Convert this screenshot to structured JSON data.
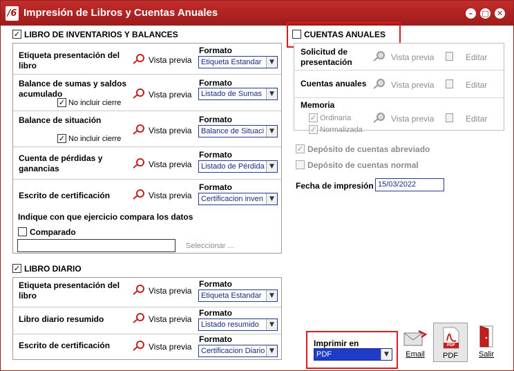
{
  "window": {
    "title": "Impresión de Libros y Cuentas Anuales",
    "logo_text": "/6"
  },
  "inventarios": {
    "checkbox_label": "LIBRO DE INVENTARIOS Y BALANCES",
    "format_heading": "Formato",
    "preview_label": "Vista previa",
    "rows": [
      {
        "label": "Etiqueta presentación del libro",
        "format": "Etiqueta Estandar"
      },
      {
        "label": "Balance de sumas y saldos acumulado",
        "format": "Listado de Sumas",
        "sub_checkbox": "No incluir cierre"
      },
      {
        "label": "Balance de situación",
        "format": "Balance de Situaci",
        "sub_checkbox": "No incluir cierre"
      },
      {
        "label": "Cuenta de pérdidas y ganancias",
        "format": "Listado de Pérdida"
      },
      {
        "label": "Escrito de certificación",
        "format": "Certificacion inven"
      }
    ],
    "compare_heading": "Indique con que ejercicio compara los datos",
    "compare_checkbox": "Comparado",
    "compare_value": "",
    "select_link": "Seleccionar ..."
  },
  "diario": {
    "checkbox_label": "LIBRO DIARIO",
    "rows": [
      {
        "label": "Etiqueta presentación del libro",
        "format": "Etiqueta Estandar"
      },
      {
        "label": "Libro diario resumido",
        "format": "Listado resumido"
      },
      {
        "label": "Escrito de certificación",
        "format": "Certificacion Diario"
      }
    ]
  },
  "cuentas": {
    "checkbox_label": "CUENTAS ANUALES",
    "preview_label": "Vista previa",
    "edit_label": "Editar",
    "rows": [
      {
        "label": "Solicitud de presentación"
      },
      {
        "label": "Cuentas anuales"
      },
      {
        "label": "Memoria",
        "options": [
          "Ordinaria",
          "Normalizada"
        ]
      }
    ],
    "deposito_abreviado": "Depósito de cuentas abreviado",
    "deposito_normal": "Depósito de cuentas normal",
    "fecha_label": "Fecha de impresión",
    "fecha_value": "15/03/2022"
  },
  "imprimir": {
    "label": "Imprimir en",
    "value": "PDF"
  },
  "toolbar": {
    "email_label": "Email",
    "pdf_label": "PDF",
    "salir_label": "Salir",
    "pdf_icon_text": "PDF"
  },
  "colors": {
    "title_bar": "#b02424",
    "combo_text": "#1b2a80",
    "highlight": "#e01a1a",
    "selection": "#1e3cc8"
  }
}
